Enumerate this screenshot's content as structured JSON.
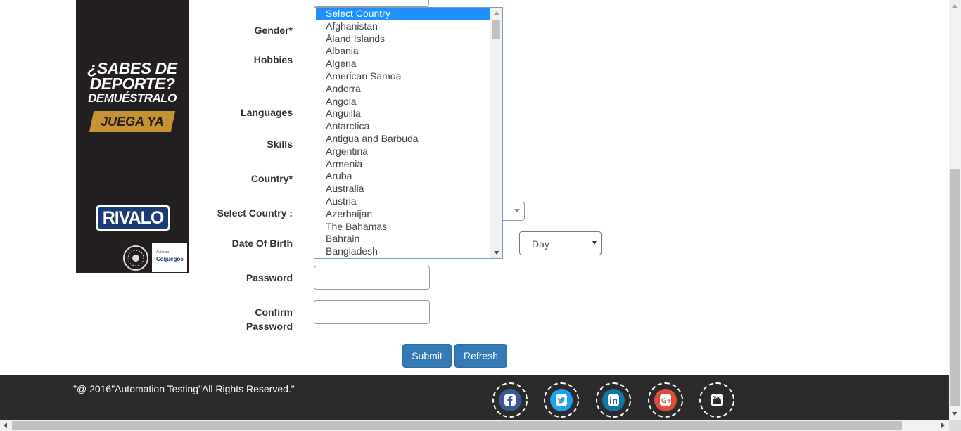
{
  "ad": {
    "headline_1": "¿SABES DE",
    "headline_2": "DEPORTE?",
    "headline_3": "DEMUÉSTRALO",
    "cta": "JUEGA YA",
    "brand": "RIVALO",
    "badge_line1": "Autoriza",
    "badge_line2": "Coljuegos",
    "colors": {
      "background": "#231f20",
      "cta": "#c69234",
      "brand": "#1b3b75"
    }
  },
  "form": {
    "labels": {
      "gender": "Gender*",
      "hobbies": "Hobbies",
      "languages": "Languages",
      "skills": "Skills",
      "country": "Country*",
      "select_country": "Select Country :",
      "dob": "Date Of Birth",
      "password": "Password",
      "confirm_line1": "Confirm",
      "confirm_line2": "Password"
    },
    "day_select_value": "Day",
    "password_value": "",
    "confirm_password_value": ""
  },
  "country_dropdown": {
    "selected": "Select Country",
    "options": [
      "Select Country",
      "Afghanistan",
      "Åland Islands",
      "Albania",
      "Algeria",
      "American Samoa",
      "Andorra",
      "Angola",
      "Anguilla",
      "Antarctica",
      "Antigua and Barbuda",
      "Argentina",
      "Armenia",
      "Aruba",
      "Australia",
      "Austria",
      "Azerbaijan",
      "The Bahamas",
      "Bahrain",
      "Bangladesh"
    ],
    "highlight_color": "#1e90ff"
  },
  "buttons": {
    "submit": "Submit",
    "refresh": "Refresh",
    "color": "#337ab7"
  },
  "footer": {
    "copyright": "\"@ 2016\"Automation Testing\"All Rights Reserved.\"",
    "background": "#2b2b2b",
    "social": [
      {
        "icon": "facebook-icon",
        "color": "#3b5998"
      },
      {
        "icon": "twitter-icon",
        "color": "#1da1f2"
      },
      {
        "icon": "linkedin-icon",
        "color": "#0e76a8"
      },
      {
        "icon": "google-plus-icon",
        "color": "#dd4b39"
      },
      {
        "icon": "youtube-icon",
        "color": "#2b2b2b"
      }
    ]
  }
}
